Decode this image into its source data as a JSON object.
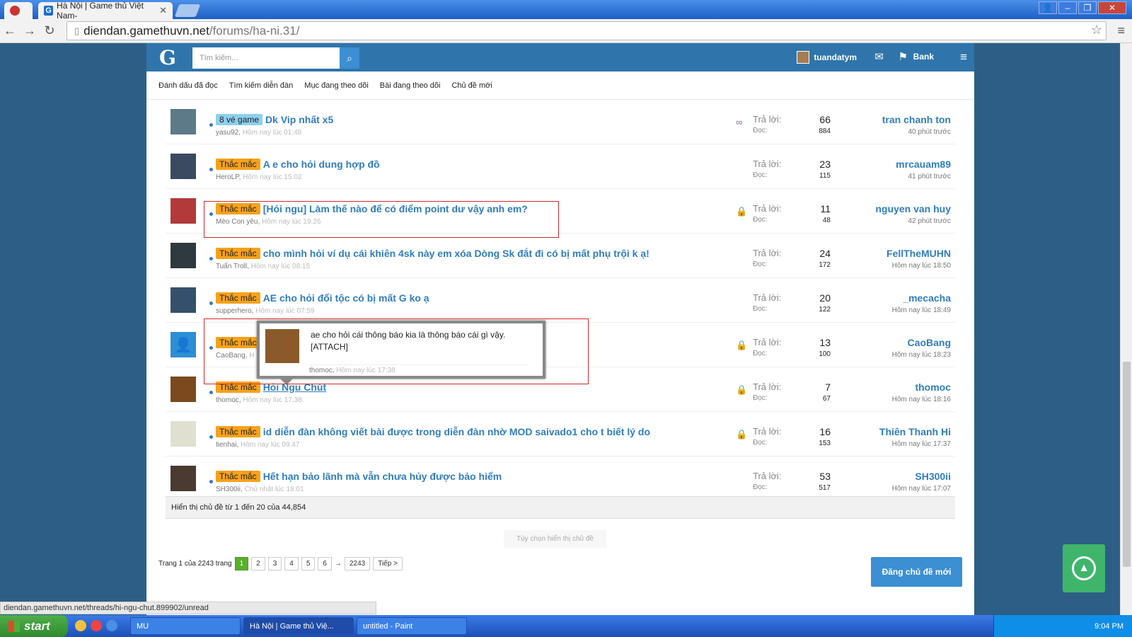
{
  "browser": {
    "tab_title": "Hà Nội | Game thủ Việt Nam-",
    "url_domain": "diendan.gamethuvn.net",
    "url_path": "/forums/ha-ni.31/",
    "status_url": "diendan.gamethuvn.net/threads/hi-ngu-chut.899902/unread"
  },
  "header": {
    "logo": "G",
    "search_placeholder": "Tìm kiếm...",
    "username": "tuandatym",
    "bank": "Bank"
  },
  "subnav": [
    "Đánh dấu đã đọc",
    "Tìm kiếm diễn đàn",
    "Mục đang theo dõi",
    "Bài đang theo dõi",
    "Chủ đề mới"
  ],
  "labels": {
    "replies": "Trả lời:",
    "views": "Đọc:"
  },
  "threads": [
    {
      "prefix": "8 vé game",
      "title": "Dk Vip nhất x5",
      "author": "yasu92,",
      "time": "Hôm nay lúc 01:48",
      "replies": "66",
      "views": "884",
      "last_user": "tran chanh ton",
      "last_time": "40 phút trước"
    },
    {
      "prefix": "Thắc mắc",
      "title": "A e cho hỏi dung hợp đồ",
      "author": "HeroLP,",
      "time": "Hôm nay lúc 15:02",
      "replies": "23",
      "views": "115",
      "last_user": "mrcauam89",
      "last_time": "41 phút trước"
    },
    {
      "prefix": "Thắc mắc",
      "title": "[Hỏi ngu] Làm thế nào để có điểm point dư vậy anh em?",
      "author": "Mèo Con yêu,",
      "time": "Hôm nay lúc 19:26",
      "replies": "11",
      "views": "48",
      "last_user": "nguyen van huy",
      "last_time": "42 phút trước"
    },
    {
      "prefix": "Thắc mắc",
      "title": "cho mình hỏi ví dụ cái khiên 4sk này em xóa Dòng Sk đắt đi có bị mất phụ trội k ạ!",
      "author": "Tuấn Troll,",
      "time": "Hôm nay lúc 08:15",
      "replies": "24",
      "views": "172",
      "last_user": "FellTheMUHN",
      "last_time": "Hôm nay lúc 18:50"
    },
    {
      "prefix": "Thắc mắc",
      "title": "AE cho hỏi đổi tộc có bị mất G ko ạ",
      "author": "supperhero,",
      "time": "Hôm nay lúc 07:59",
      "replies": "20",
      "views": "122",
      "last_user": "_mecacha",
      "last_time": "Hôm nay lúc 18:49"
    },
    {
      "prefix": "Thắc mắc",
      "title": "",
      "author": "CaoBang,",
      "time": "H",
      "replies": "13",
      "views": "100",
      "last_user": "CaoBang",
      "last_time": "Hôm nay lúc 18:23"
    },
    {
      "prefix": "Thắc mắc",
      "title": "Hỏi Ngu Chút",
      "author": "thomoc,",
      "time": "Hôm nay lúc 17:38",
      "replies": "7",
      "views": "67",
      "last_user": "thomoc",
      "last_time": "Hôm nay lúc 18:16"
    },
    {
      "prefix": "Thắc mắc",
      "title": "id diễn đàn không viết bài được trong diễn đàn nhờ MOD saivado1 cho t biết lý do",
      "author": "tienhai,",
      "time": "Hôm nay lúc 09:47",
      "replies": "16",
      "views": "153",
      "last_user": "Thiên Thanh Hi",
      "last_time": "Hôm nay lúc 17:37"
    },
    {
      "prefix": "Thắc mắc",
      "title": "Hết hạn bảo lãnh mà vẫn chưa hủy được bảo hiểm",
      "author": "SH300ii,",
      "time": "Chủ nhật lúc 18:01",
      "replies": "53",
      "views": "517",
      "last_user": "SH300ii",
      "last_time": "Hôm nay lúc 17:07"
    }
  ],
  "tooltip": {
    "line1": "ae cho hỏi cái thông báo kia là thông báo cái gì vậy.",
    "line2": "[ATTACH]",
    "author": "thomoc,",
    "time": "Hôm nay lúc 17:38"
  },
  "summary": "Hiển thị chủ đề từ 1 đến 20 của 44,854",
  "options": "Tùy chọn hiển thị chủ đề",
  "pager": {
    "label": "Trang 1 của 2243 trang",
    "pages": [
      "1",
      "2",
      "3",
      "4",
      "5",
      "6"
    ],
    "ellipsis": "→",
    "last": "2243",
    "next": "Tiếp >"
  },
  "post_button": "Đăng chủ đề mới",
  "taskbar": {
    "start": "start",
    "items": [
      "MU",
      "Hà Nội | Game thủ Việ...",
      "untitled - Paint"
    ],
    "clock": "9:04 PM"
  }
}
